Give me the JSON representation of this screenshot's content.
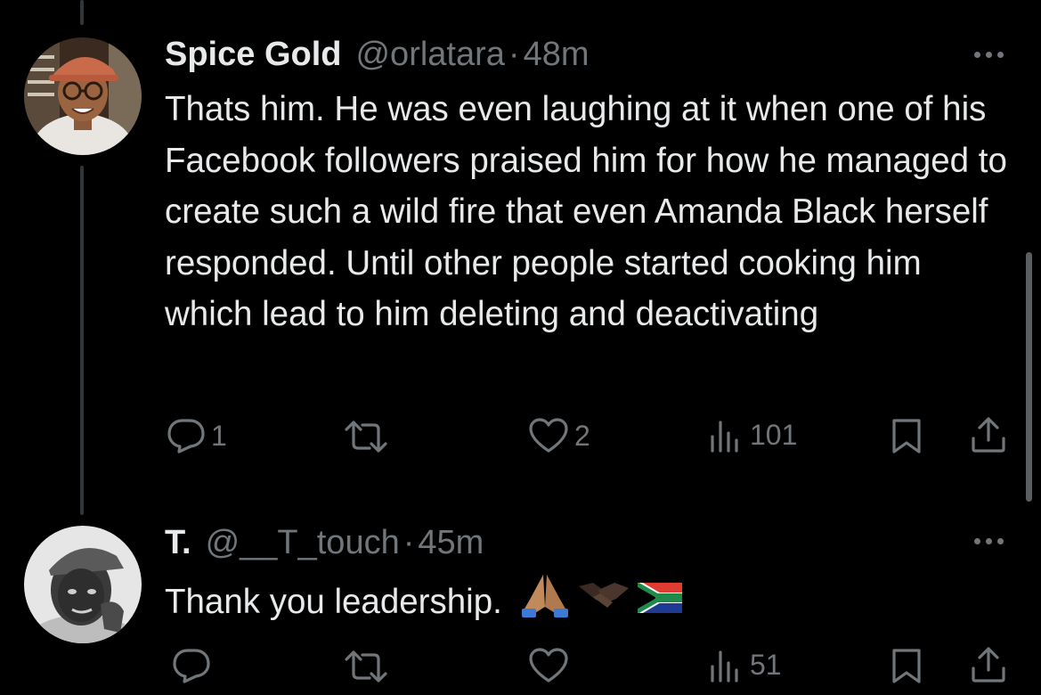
{
  "tweets": [
    {
      "name": "Spice Gold",
      "handle": "@orlatara",
      "separator": "·",
      "time": "48m",
      "text": "Thats him. He was even laughing at it when one of his Facebook followers praised him for how he managed to create such a wild fire that even Amanda Black herself responded. Until other people started cooking him which lead to him deleting and deactivating",
      "counts": {
        "replies": "1",
        "retweets": "",
        "likes": "2",
        "views": "101"
      }
    },
    {
      "name": "T.",
      "handle": "@__T_touch",
      "separator": "·",
      "time": "45m",
      "text": "Thank you leadership.",
      "emojis": [
        "folded-hands",
        "handshake",
        "south-africa-flag"
      ],
      "counts": {
        "replies": "",
        "retweets": "",
        "likes": "",
        "views": "51"
      }
    }
  ],
  "colors": {
    "background": "#000000",
    "text": "#e7e9ea",
    "secondary": "#71767b",
    "thread_line": "#333639"
  },
  "icons": [
    "reply-icon",
    "retweet-icon",
    "like-icon",
    "views-icon",
    "bookmark-icon",
    "share-icon",
    "more-icon"
  ]
}
